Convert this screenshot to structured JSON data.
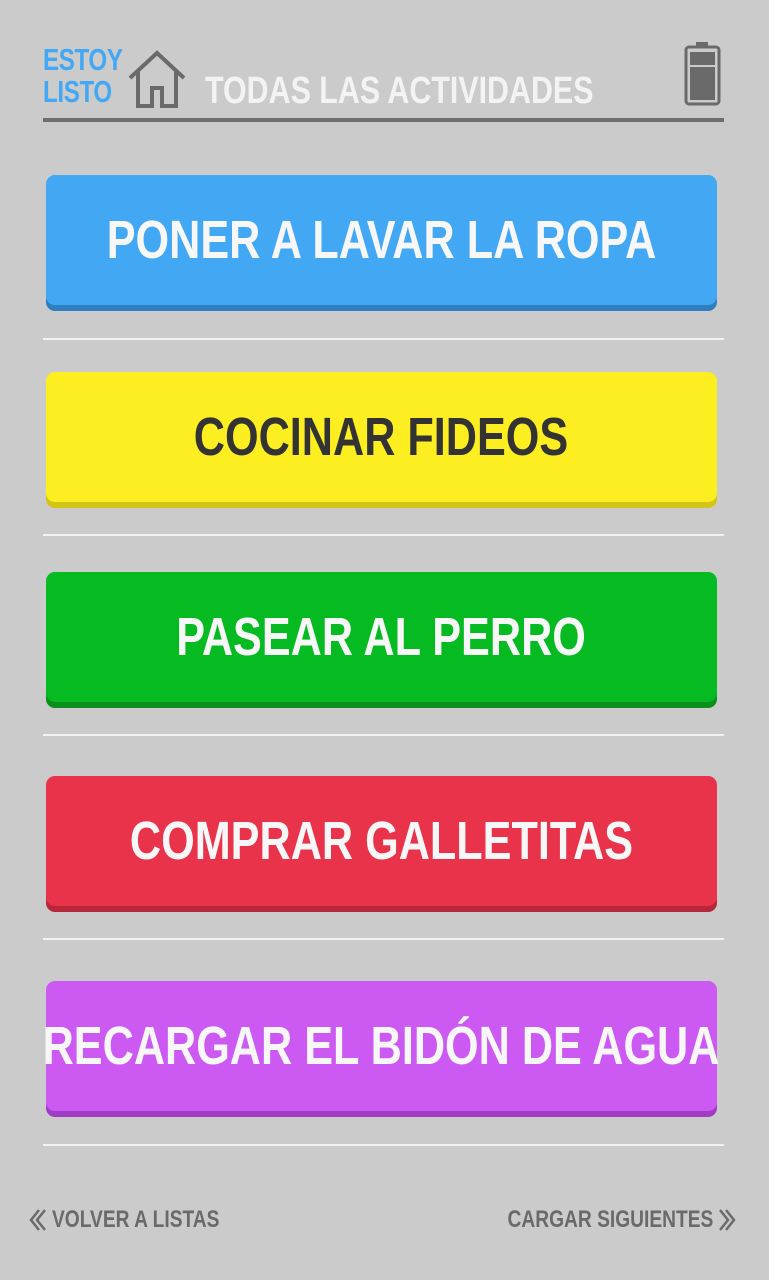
{
  "app": {
    "logo_line1": "ESTOY",
    "logo_line2": "LISTO",
    "title": "TODAS LAS ACTIVIDADES",
    "icons": {
      "home": "home-icon",
      "battery": "battery-icon"
    }
  },
  "activities": [
    {
      "label": "PONER A LAVAR LA ROPA",
      "color": "#43a8f4"
    },
    {
      "label": "COCINAR FIDEOS",
      "color": "#fcee21"
    },
    {
      "label": "PASEAR AL PERRO",
      "color": "#06bb21"
    },
    {
      "label": "COMPRAR GALLETITAS",
      "color": "#e8334a"
    },
    {
      "label": "RECARGAR EL BIDÓN DE AGUA",
      "color": "#cc5af2"
    }
  ],
  "footer": {
    "back_label": "VOLVER A LISTAS",
    "next_label": "CARGAR SIGUIENTES"
  },
  "colors": {
    "background": "#cbcbcb",
    "logo": "#42a8f3",
    "title": "#f3f3f3",
    "footer_text": "#6a6a6a"
  }
}
